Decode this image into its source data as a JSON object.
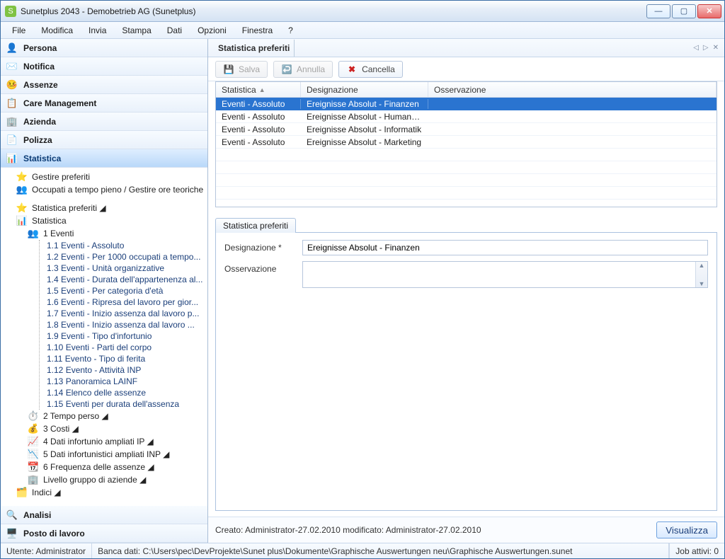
{
  "window": {
    "title": "Sunetplus 2043 - Demobetrieb AG (Sunetplus)"
  },
  "menu": {
    "items": [
      "File",
      "Modifica",
      "Invia",
      "Stampa",
      "Dati",
      "Opzioni",
      "Finestra",
      "?"
    ]
  },
  "sidebar": {
    "sections": [
      {
        "label": "Persona",
        "icon": "👤",
        "selected": false
      },
      {
        "label": "Notifica",
        "icon": "✉️",
        "selected": false
      },
      {
        "label": "Assenze",
        "icon": "🤒",
        "selected": false
      },
      {
        "label": "Care Management",
        "icon": "📋",
        "selected": false
      },
      {
        "label": "Azienda",
        "icon": "🏢",
        "selected": false
      },
      {
        "label": "Polizza",
        "icon": "📄",
        "selected": false
      },
      {
        "label": "Statistica",
        "icon": "📊",
        "selected": true
      }
    ],
    "statistica": {
      "top": [
        {
          "icon": "⭐",
          "label": "Gestire preferiti"
        },
        {
          "icon": "👥",
          "label": "Occupati a tempo pieno / Gestire ore teoriche"
        }
      ],
      "favorites": {
        "icon": "⭐",
        "label": "Statistica preferiti ◢"
      },
      "root": {
        "icon": "📊",
        "label": "Statistica"
      },
      "group1": {
        "icon": "👥",
        "label": "1 Eventi"
      },
      "items1": [
        "1.1 Eventi - Assoluto",
        "1.2 Eventi - Per 1000 occupati a tempo...",
        "1.3 Eventi - Unità organizzative",
        "1.4 Eventi - Durata dell'appartenenza al...",
        "1.5 Eventi - Per categoria d'età",
        "1.6 Eventi - Ripresa del lavoro per gior...",
        "1.7 Eventi - Inizio assenza dal lavoro p...",
        "1.8 Eventi - Inizio assenza dal lavoro ...",
        "1.9 Eventi - Tipo d'infortunio",
        "1.10 Eventi - Parti del corpo",
        "1.11 Evento - Tipo di ferita",
        "1.12 Evento - Attività INP",
        "1.13 Panoramica LAINF",
        "1.14 Elenco delle assenze",
        "1.15 Eventi per durata dell'assenza"
      ],
      "groups_rest": [
        {
          "icon": "⏱️",
          "label": "2 Tempo perso ◢"
        },
        {
          "icon": "💰",
          "label": "3 Costi ◢"
        },
        {
          "icon": "📈",
          "label": "4 Dati infortunio ampliati IP ◢"
        },
        {
          "icon": "📉",
          "label": "5 Dati infortunistici ampliati INP ◢"
        },
        {
          "icon": "📆",
          "label": "6 Frequenza delle assenze ◢"
        },
        {
          "icon": "🏢",
          "label": "Livello gruppo di aziende ◢"
        }
      ],
      "indici": {
        "icon": "🗂️",
        "label": "Indici ◢"
      }
    },
    "bottom_sections": [
      {
        "label": "Analisi",
        "icon": "🔍"
      },
      {
        "label": "Posto di lavoro",
        "icon": "🖥️"
      }
    ]
  },
  "main": {
    "header_title": "Statistica preferiti",
    "toolbar": {
      "salva": {
        "label": "Salva",
        "icon": "💾",
        "disabled": true
      },
      "annulla": {
        "label": "Annulla",
        "icon": "↩️",
        "disabled": true
      },
      "cancella": {
        "label": "Cancella",
        "icon": "✖",
        "disabled": false
      }
    },
    "grid": {
      "columns": {
        "c1": "Statistica",
        "c2": "Designazione",
        "c3": "Osservazione"
      },
      "sort_indicator": "▲",
      "rows": [
        {
          "c1": "Eventi - Assoluto",
          "c2": "Ereignisse Absolut - Finanzen",
          "c3": "",
          "selected": true
        },
        {
          "c1": "Eventi - Assoluto",
          "c2": "Ereignisse Absolut - Human Ressources",
          "c3": "",
          "selected": false
        },
        {
          "c1": "Eventi - Assoluto",
          "c2": "Ereignisse Absolut - Informatik",
          "c3": "",
          "selected": false
        },
        {
          "c1": "Eventi - Assoluto",
          "c2": "Ereignisse Absolut - Marketing",
          "c3": "",
          "selected": false
        }
      ]
    },
    "form": {
      "tab": "Statistica preferiti",
      "designazione_label": "Designazione *",
      "designazione_value": "Ereignisse Absolut - Finanzen",
      "osservazione_label": "Osservazione",
      "osservazione_value": ""
    },
    "footer": {
      "meta": "Creato: Administrator-27.02.2010  modificato: Administrator-27.02.2010",
      "visualizza": "Visualizza"
    }
  },
  "statusbar": {
    "user": "Utente: Administrator",
    "db": "Banca dati: C:\\Users\\pec\\DevProjekte\\Sunet plus\\Dokumente\\Graphische Auswertungen neu\\Graphische Auswertungen.sunet",
    "jobs": "Job attivi: 0"
  }
}
